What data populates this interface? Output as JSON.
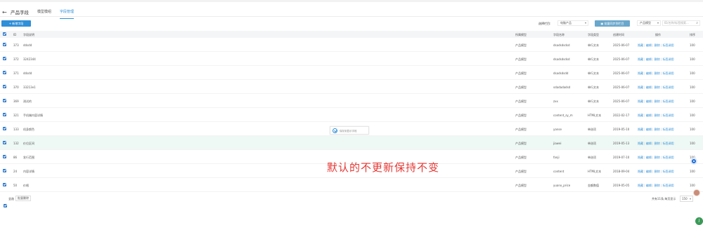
{
  "header": {
    "back_icon": "arrow-left-icon",
    "title": "产品字段",
    "tabs": [
      {
        "label": "模型模组",
        "active": false
      },
      {
        "label": "字段管理",
        "active": true
      }
    ]
  },
  "toolbar": {
    "new_button": "+ 新增字段",
    "select_label": "选择栏目:",
    "select_value": "电脑产品",
    "check_button": "▣ 批量同步到栏目",
    "filter_value": "产品模型",
    "search_placeholder": "ID/名称/标签搜索..."
  },
  "table": {
    "columns": {
      "id": "ID",
      "name": "字段说明",
      "model": "所属模型",
      "field_name": "字段名称",
      "field_type": "字段类型",
      "created": "创建时间",
      "actions": "操作",
      "sort": "排序"
    },
    "rows": [
      {
        "id": "373",
        "name": "ddsdd",
        "model": "产品模型",
        "field_name": "dsadsdsdsd",
        "field_type": "单行文本",
        "created": "2025-06-07",
        "sort": "100",
        "action1": "隐藏",
        "action2": "编辑",
        "action3": "删除",
        "action4": "标签调用"
      },
      {
        "id": "372",
        "name": "3242344",
        "model": "产品模型",
        "field_name": "dsadsdsdsd",
        "field_type": "单行文本",
        "created": "2025-06-07",
        "sort": "100",
        "action1": "隐藏",
        "action2": "编辑",
        "action3": "删除",
        "action4": "标签调用"
      },
      {
        "id": "371",
        "name": "ddsdd",
        "model": "产品模型",
        "field_name": "dsadsdsdd",
        "field_type": "单行文本",
        "created": "2025-06-07",
        "sort": "100",
        "action1": "隐藏",
        "action2": "编辑",
        "action3": "删除",
        "action4": "标签调用"
      },
      {
        "id": "370",
        "name": "33213e1",
        "model": "产品模型",
        "field_name": "sdadadadsd",
        "field_type": "单行文本",
        "created": "2025-06-07",
        "sort": "100",
        "action1": "隐藏",
        "action2": "编辑",
        "action3": "删除",
        "action4": "标签调用"
      },
      {
        "id": "369",
        "name": "测试的",
        "model": "产品模型",
        "field_name": "zxx",
        "field_type": "单行文本",
        "created": "2025-06-07",
        "sort": "100",
        "action1": "隐藏",
        "action2": "编辑",
        "action3": "删除",
        "action4": "标签调用"
      },
      {
        "id": "321",
        "name": "手机端内容详情",
        "model": "产品模型",
        "field_name": "content_sy_m",
        "field_type": "HTML文本",
        "created": "2022-02-17",
        "sort": "100",
        "action1": "隐藏",
        "action2": "编辑",
        "action3": "删除",
        "action4": "标签调用"
      },
      {
        "id": "133",
        "name": "机身颜色",
        "model": "产品模型",
        "field_name": "yanse",
        "field_type": "单选项",
        "created": "2019-05-10",
        "sort": "100",
        "action1": "隐藏",
        "action2": "编辑",
        "action3": "删除",
        "action4": "标签调用"
      },
      {
        "id": "132",
        "name": "价位区间",
        "model": "产品模型",
        "field_name": "jiawei",
        "field_type": "单选项",
        "created": "2019-05-13",
        "sort": "100",
        "action1": "隐藏",
        "action2": "编辑",
        "action3": "删除",
        "action4": "标签调用"
      },
      {
        "id": "86",
        "name": "发行范围",
        "model": "产品模型",
        "field_name": "fanji",
        "field_type": "单选项",
        "created": "2019-07-10",
        "sort": "100",
        "action1": "隐藏",
        "action2": "编辑",
        "action3": "删除",
        "action4": "标签调用"
      },
      {
        "id": "24",
        "name": "内容详情",
        "model": "产品模型",
        "field_name": "content",
        "field_type": "HTML文本",
        "created": "2018-09-04",
        "sort": "100",
        "action1": "隐藏",
        "action2": "编辑",
        "action3": "删除",
        "action4": "标签调用"
      },
      {
        "id": "50",
        "name": "价格",
        "model": "产品模型",
        "field_name": "yuanx_price",
        "field_type": "金额数值",
        "created": "2019-05-05",
        "sort": "100",
        "action1": "隐藏",
        "action2": "编辑",
        "action3": "删除",
        "action4": "标签调用"
      }
    ]
  },
  "toast": "保存到显示字段",
  "overlay": "默认的不更新保持不变",
  "footer": {
    "select_all": "全选",
    "batch_delete": "批量删除",
    "info": "共有11条,每页显示",
    "page_size": "150"
  },
  "colors": {
    "accent": "#2f8fd8",
    "highlight_row": "#eef8f4",
    "overlay_text": "#e53935"
  }
}
